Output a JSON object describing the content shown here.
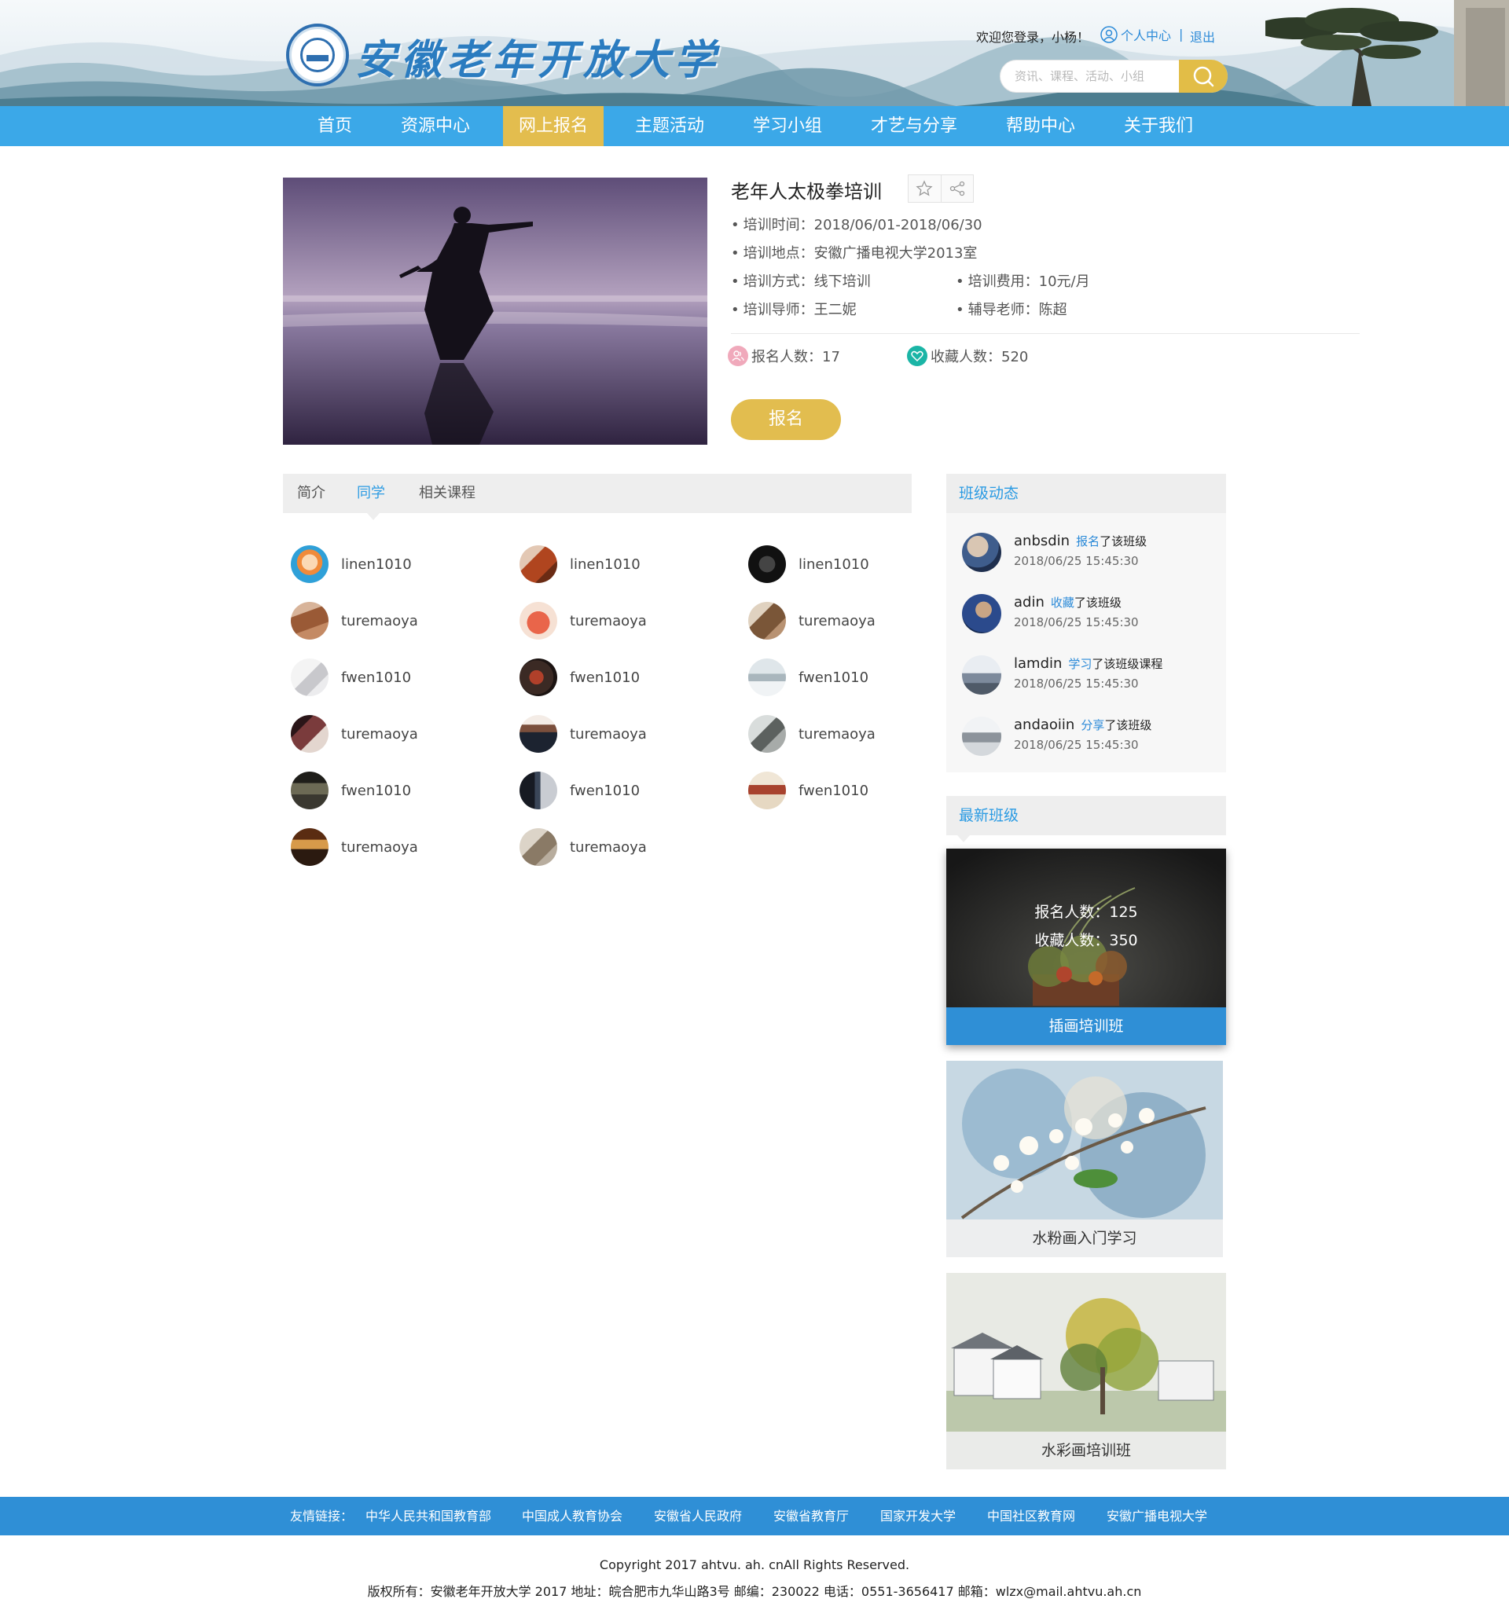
{
  "header": {
    "logo_text": "安徽老年开放大学",
    "welcome": "欢迎您登录，小杨！",
    "user_center": "个人中心",
    "separator": "|",
    "logout": "退出",
    "search_placeholder": "资讯、课程、活动、小组"
  },
  "nav": {
    "items": [
      {
        "label": "首页"
      },
      {
        "label": "资源中心"
      },
      {
        "label": "网上报名"
      },
      {
        "label": "主题活动"
      },
      {
        "label": "学习小组"
      },
      {
        "label": "才艺与分享"
      },
      {
        "label": "帮助中心"
      },
      {
        "label": "关于我们"
      }
    ],
    "active_index": 2
  },
  "course": {
    "title": "老年人太极拳培训",
    "time": "培训时间：2018/06/01-2018/06/30",
    "location": "培训地点：安徽广播电视大学2013室",
    "mode": "培训方式：线下培训",
    "fee": "培训费用：10元/月",
    "teacher": "培训导师：王二妮",
    "assistant": "辅导老师：陈超",
    "enrolled": "报名人数：17",
    "favorites": "收藏人数：520",
    "signup_button": "报名"
  },
  "tabs": {
    "items": [
      {
        "label": "简介"
      },
      {
        "label": "同学"
      },
      {
        "label": "相关课程"
      }
    ],
    "active_index": 1
  },
  "classmates": [
    {
      "name": "linen1010"
    },
    {
      "name": "linen1010"
    },
    {
      "name": "linen1010"
    },
    {
      "name": "turemaoya"
    },
    {
      "name": "turemaoya"
    },
    {
      "name": "turemaoya"
    },
    {
      "name": "fwen1010"
    },
    {
      "name": "fwen1010"
    },
    {
      "name": "fwen1010"
    },
    {
      "name": "turemaoya"
    },
    {
      "name": "turemaoya"
    },
    {
      "name": "turemaoya"
    },
    {
      "name": "fwen1010"
    },
    {
      "name": "fwen1010"
    },
    {
      "name": "fwen1010"
    },
    {
      "name": "turemaoya"
    },
    {
      "name": "turemaoya"
    }
  ],
  "sidebar": {
    "feed_title": "班级动态",
    "feed": [
      {
        "name": "anbsdin",
        "action": "报名",
        "rest": "了该班级",
        "time": "2018/06/25  15:45:30"
      },
      {
        "name": "adin",
        "action": "收藏",
        "rest": "了该班级",
        "time": "2018/06/25  15:45:30"
      },
      {
        "name": "lamdin",
        "action": "学习",
        "rest": "了该班级课程",
        "time": "2018/06/25  15:45:30"
      },
      {
        "name": "andaoiin",
        "action": "分享",
        "rest": "了该班级",
        "time": "2018/06/25  15:45:30"
      }
    ],
    "new_title": "最新班级",
    "classes": [
      {
        "name": "插画培训班",
        "enrolled": "报名人数：125",
        "favorites": "收藏人数：350"
      },
      {
        "name": "水粉画入门学习"
      },
      {
        "name": "水彩画培训班"
      }
    ]
  },
  "footer": {
    "links_label": "友情链接：",
    "links": [
      {
        "label": "中华人民共和国教育部"
      },
      {
        "label": "中国成人教育协会"
      },
      {
        "label": "安徽省人民政府"
      },
      {
        "label": "安徽省教育厅"
      },
      {
        "label": "国家开发大学"
      },
      {
        "label": "中国社区教育网"
      },
      {
        "label": "安徽广播电视大学"
      }
    ],
    "copyright": "Copyright 2017 ahtvu. ah. cnAll Rights Reserved.",
    "address": "版权所有：安徽老年开放大学 2017 地址：皖合肥市九华山路3号 邮编：230022 电话：0551-3656417 邮箱：wlzx@mail.ahtvu.ah.cn"
  },
  "colors": {
    "nav_blue": "#3ba8e8",
    "accent_gold": "#e2bd4f",
    "link_blue": "#2b8ad8",
    "footer_blue": "#2f8fd6"
  }
}
